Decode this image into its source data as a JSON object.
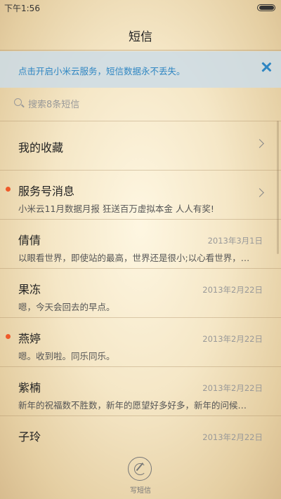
{
  "status": {
    "time": "下午1:56"
  },
  "header": {
    "title": "短信"
  },
  "banner": {
    "text": "点击开启小米云服务，短信数据永不丢失。"
  },
  "search": {
    "placeholder": "搜索8条短信"
  },
  "list": [
    {
      "name": "我的收藏",
      "preview": "",
      "date": "",
      "unread": false,
      "chevron": true
    },
    {
      "name": "服务号消息",
      "preview": "小米云11月数据月报 狂送百万虚拟本金 人人有奖!",
      "date": "",
      "unread": true,
      "chevron": true
    },
    {
      "name": "倩倩",
      "preview": "以眼看世界，即使站的最高，世界还是很小;以心看世界，…",
      "date": "2013年3月1日",
      "unread": false,
      "chevron": false
    },
    {
      "name": "果冻",
      "preview": "嗯，今天会回去的早点。",
      "date": "2013年2月22日",
      "unread": false,
      "chevron": false
    },
    {
      "name": "燕婷",
      "preview": "嗯。收到啦。同乐同乐。",
      "date": "2013年2月22日",
      "unread": true,
      "chevron": false
    },
    {
      "name": "紫楠",
      "preview": "新年的祝福数不胜数，新年的愿望好多好多，新年的问候…",
      "date": "2013年2月22日",
      "unread": false,
      "chevron": false
    },
    {
      "name": "子玲",
      "preview": "",
      "date": "2013年2月22日",
      "unread": false,
      "chevron": false
    }
  ],
  "compose": {
    "label": "写短信"
  },
  "colors": {
    "accent": "#2f86c2",
    "unread_dot": "#ef5a2a"
  }
}
